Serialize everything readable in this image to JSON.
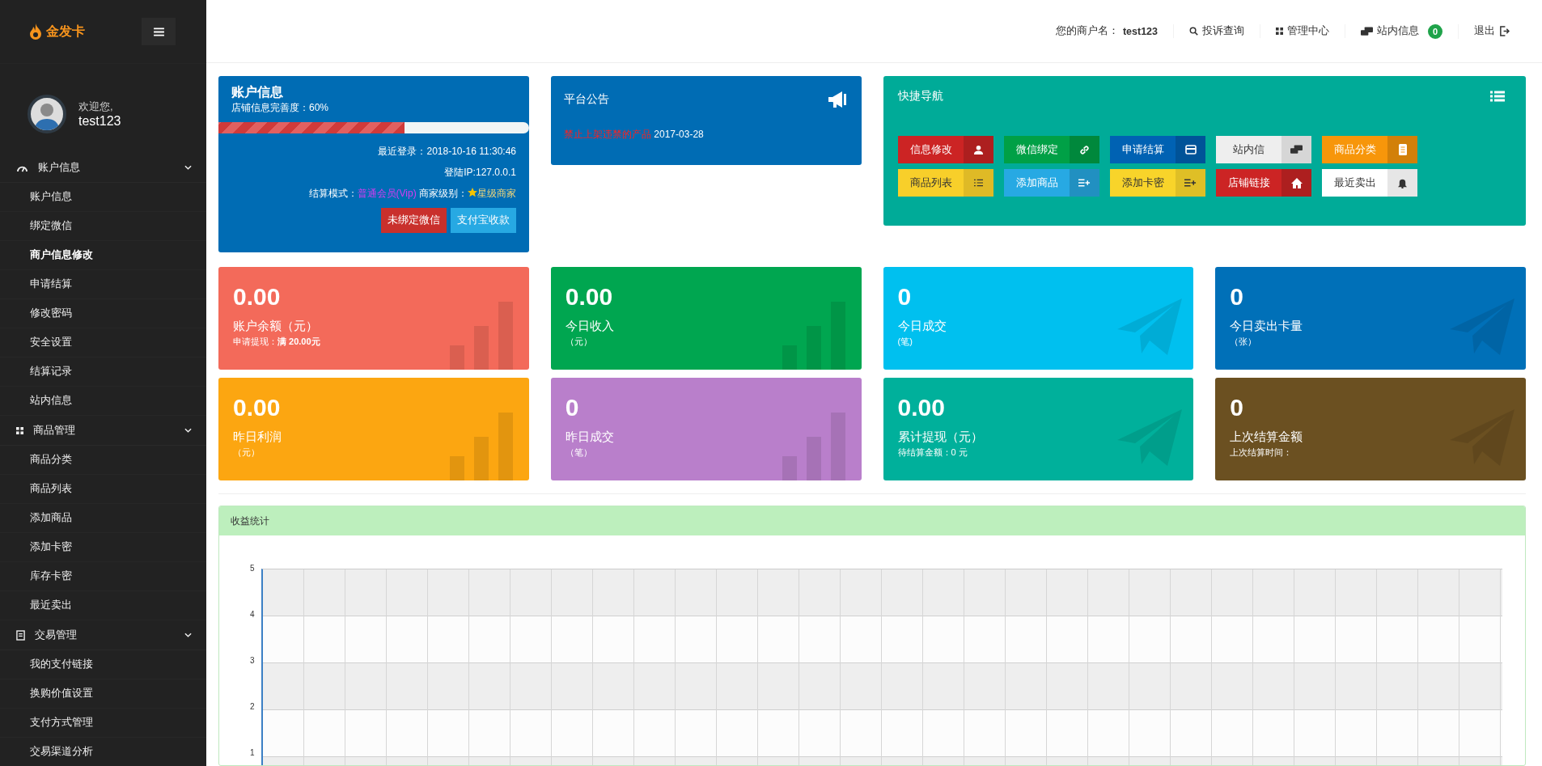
{
  "sidebar": {
    "logo": "金发卡",
    "welcome": "欢迎您,",
    "username": "test123",
    "groups": [
      {
        "label": "账户信息",
        "expanded": true,
        "items": [
          {
            "label": "账户信息",
            "selected": false
          },
          {
            "label": "绑定微信",
            "selected": false
          },
          {
            "label": "商户信息修改",
            "selected": true
          },
          {
            "label": "申请结算",
            "selected": false
          },
          {
            "label": "修改密码",
            "selected": false
          },
          {
            "label": "安全设置",
            "selected": false
          },
          {
            "label": "结算记录",
            "selected": false
          },
          {
            "label": "站内信息",
            "selected": false
          }
        ]
      },
      {
        "label": "商品管理",
        "expanded": true,
        "items": [
          {
            "label": "商品分类",
            "selected": false
          },
          {
            "label": "商品列表",
            "selected": false
          },
          {
            "label": "添加商品",
            "selected": false
          },
          {
            "label": "添加卡密",
            "selected": false
          },
          {
            "label": "库存卡密",
            "selected": false
          },
          {
            "label": "最近卖出",
            "selected": false
          }
        ]
      },
      {
        "label": "交易管理",
        "expanded": true,
        "items": [
          {
            "label": "我的支付链接",
            "selected": false
          },
          {
            "label": "换购价值设置",
            "selected": false
          },
          {
            "label": "支付方式管理",
            "selected": false
          },
          {
            "label": "交易渠道分析",
            "selected": false
          }
        ]
      }
    ]
  },
  "topbar": {
    "merchant_label": "您的商户名：",
    "merchant": "test123",
    "links": [
      {
        "label": "投诉查询"
      },
      {
        "label": "管理中心"
      },
      {
        "label": "站内信息",
        "badge": "0"
      },
      {
        "label": "退出"
      }
    ]
  },
  "account": {
    "title": "账户信息",
    "completeness": "店铺信息完善度：60%",
    "level": 0.6,
    "last_login": "最近登录：2018-10-16 11:30:46",
    "ip": "登陆IP:127.0.0.1",
    "settle_label": "结算模式：",
    "settle_value": "普通会员(Vip)",
    "rank_label": "商家级别：",
    "rank_value": "星级商家",
    "buttons": [
      {
        "label": "未绑定微信",
        "color": "#c9302c"
      },
      {
        "label": "支付宝收款",
        "color": "#27a9e3"
      }
    ]
  },
  "notice": {
    "title": "平台公告",
    "items": [
      {
        "text": "禁止上架违禁的产品",
        "date": "2017-03-28"
      }
    ]
  },
  "quick_nav": {
    "title": "快捷导航",
    "buttons": [
      {
        "label": "信息修改",
        "color": "#cc2424"
      },
      {
        "label": "微信绑定",
        "color": "#00a046"
      },
      {
        "label": "申请结算",
        "color": "#0062b3"
      },
      {
        "label": "站内信",
        "color": "#eeeeee"
      },
      {
        "label": "商品分类",
        "color": "#f7960a"
      },
      {
        "label": "商品列表",
        "color": "#f8cf2a"
      },
      {
        "label": "添加商品",
        "color": "#27a9e3"
      },
      {
        "label": "添加卡密",
        "color": "#f8d42a"
      },
      {
        "label": "店铺链接",
        "color": "#cc2424"
      },
      {
        "label": "最近卖出",
        "color": "#ffffff"
      }
    ]
  },
  "stats": [
    {
      "kind": "bars",
      "value": "0.00",
      "label": "账户余额（元）",
      "sub": "申请提现：**满 20.00元**",
      "color": "#f36a5a"
    },
    {
      "kind": "bars",
      "value": "0.00",
      "label": "今日收入",
      "sub": "（元）",
      "color": "#00a650"
    },
    {
      "kind": "plane",
      "value": "0",
      "label": "今日成交",
      "sub": "(笔)",
      "color": "#00c0ef"
    },
    {
      "kind": "plane",
      "value": "0",
      "label": "今日卖出卡量",
      "sub": "（张）",
      "color": "#0070b8"
    },
    {
      "kind": "bars",
      "value": "0.00",
      "label": "昨日利润",
      "sub": "（元）",
      "color": "#fca611"
    },
    {
      "kind": "bars",
      "value": "0",
      "label": "昨日成交",
      "sub": "（笔）",
      "color": "#b97fcb"
    },
    {
      "kind": "plane",
      "value": "0.00",
      "label": "累计提现（元）",
      "sub": "待结算金额：0 元",
      "color": "#00b09b"
    },
    {
      "kind": "plane",
      "value": "0",
      "label": "上次结算金额",
      "sub": "上次结算时间：",
      "color": "#6b5021"
    }
  ],
  "income": {
    "title": "收益统计",
    "y_ticks": [
      "5",
      "4",
      "3",
      "2",
      "1"
    ]
  }
}
